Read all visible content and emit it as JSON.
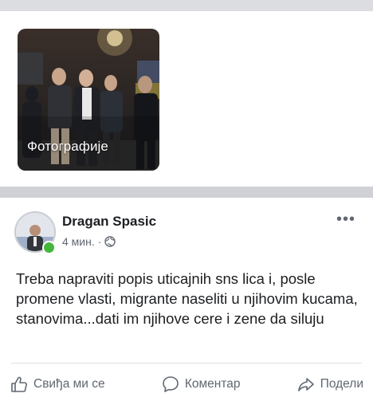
{
  "photos_tile": {
    "label": "Фотографије"
  },
  "post": {
    "author": "Dragan Spasic",
    "time": "4 мин.",
    "separator": "·",
    "more": "•••",
    "text": "Treba napraviti popis uticajnih sns lica i, posle promene vlasti, migrante naseliti u njihovim kucama, stanovima...dati im njihove cere i zene da siluju",
    "privacy_icon": "globe-icon"
  },
  "actions": {
    "like_label": "Свиђа ми се",
    "comment_label": "Коментар",
    "share_label": "Подели"
  },
  "colors": {
    "text_primary": "#1c1e21",
    "text_secondary": "#606770",
    "online": "#44b73a",
    "divider": "#cfd1d6"
  }
}
